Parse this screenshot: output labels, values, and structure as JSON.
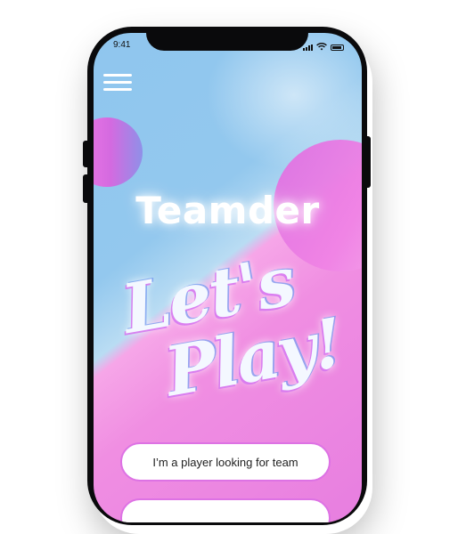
{
  "status_bar": {
    "time": "9:41"
  },
  "app": {
    "title": "Teamder"
  },
  "hero": {
    "line1": "Let's",
    "line2": "Play!"
  },
  "buttons": {
    "player_looking_for_team": "I’m a player looking for team",
    "second_option": ""
  },
  "colors": {
    "background_blue": "#8fc6ee",
    "background_pink": "#f08ee2",
    "button_border": "#dd72e4"
  },
  "icons": [
    "menu-icon",
    "signal-icon",
    "wifi-icon",
    "battery-icon"
  ]
}
